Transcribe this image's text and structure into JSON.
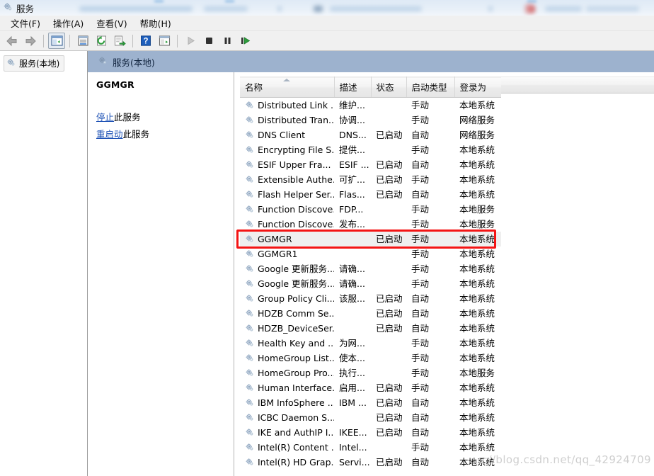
{
  "window": {
    "title": "服务",
    "icon": "services-gear-icon"
  },
  "menubar": {
    "items": [
      {
        "label": "文件(F)",
        "name": "menu-file"
      },
      {
        "label": "操作(A)",
        "name": "menu-action"
      },
      {
        "label": "查看(V)",
        "name": "menu-view"
      },
      {
        "label": "帮助(H)",
        "name": "menu-help"
      }
    ]
  },
  "toolbar": {
    "buttons": [
      {
        "name": "back-button",
        "icon": "left-arrow-icon",
        "enabled": true
      },
      {
        "name": "forward-button",
        "icon": "right-arrow-icon",
        "enabled": true
      },
      {
        "name": "show-hide-tree-button",
        "icon": "tree-panel-icon",
        "enabled": true
      },
      {
        "name": "properties-button",
        "icon": "properties-icon",
        "enabled": true
      },
      {
        "name": "refresh-button",
        "icon": "refresh-icon",
        "enabled": true
      },
      {
        "name": "export-list-button",
        "icon": "export-icon",
        "enabled": true
      },
      {
        "name": "help-button",
        "icon": "question-mark-icon",
        "enabled": true
      },
      {
        "name": "show-console-tree-button",
        "icon": "console-view-icon",
        "enabled": true
      },
      {
        "name": "start-service-button",
        "icon": "play-icon",
        "enabled": false
      },
      {
        "name": "stop-service-button",
        "icon": "stop-icon",
        "enabled": true
      },
      {
        "name": "pause-service-button",
        "icon": "pause-icon",
        "enabled": true
      },
      {
        "name": "restart-service-button",
        "icon": "restart-icon",
        "enabled": true
      }
    ]
  },
  "tree": {
    "items": [
      {
        "label": "服务(本地)",
        "name": "tree-item-services-local",
        "selected": true
      }
    ]
  },
  "content": {
    "header_title": "服务(本地)"
  },
  "details": {
    "service_name": "GGMGR",
    "links": [
      {
        "verb": "停止",
        "rest": "此服务",
        "name": "stop-this-service-link"
      },
      {
        "verb": "重启动",
        "rest": "此服务",
        "name": "restart-this-service-link"
      }
    ]
  },
  "table": {
    "columns": [
      {
        "label": "名称",
        "name": "column-name",
        "sorted": "asc"
      },
      {
        "label": "描述",
        "name": "column-description"
      },
      {
        "label": "状态",
        "name": "column-status"
      },
      {
        "label": "启动类型",
        "name": "column-startup-type"
      },
      {
        "label": "登录为",
        "name": "column-log-on-as"
      }
    ],
    "rows": [
      {
        "name": "Distributed Link ...",
        "description": "维护...",
        "status": "",
        "startup": "手动",
        "logon": "本地系统"
      },
      {
        "name": "Distributed Tran...",
        "description": "协调...",
        "status": "",
        "startup": "手动",
        "logon": "网络服务"
      },
      {
        "name": "DNS Client",
        "description": "DNS...",
        "status": "已启动",
        "startup": "自动",
        "logon": "网络服务"
      },
      {
        "name": "Encrypting File S...",
        "description": "提供...",
        "status": "",
        "startup": "手动",
        "logon": "本地系统"
      },
      {
        "name": "ESIF Upper Fra...",
        "description": "ESIF ...",
        "status": "已启动",
        "startup": "自动",
        "logon": "本地系统"
      },
      {
        "name": "Extensible Authe...",
        "description": "可扩...",
        "status": "已启动",
        "startup": "手动",
        "logon": "本地系统"
      },
      {
        "name": "Flash Helper Ser...",
        "description": "Flas...",
        "status": "已启动",
        "startup": "自动",
        "logon": "本地系统"
      },
      {
        "name": "Function Discove...",
        "description": "FDP...",
        "status": "",
        "startup": "手动",
        "logon": "本地服务"
      },
      {
        "name": "Function Discove...",
        "description": "发布...",
        "status": "",
        "startup": "手动",
        "logon": "本地服务"
      },
      {
        "name": "GGMGR",
        "description": "",
        "status": "已启动",
        "startup": "手动",
        "logon": "本地系统",
        "selected": true
      },
      {
        "name": "GGMGR1",
        "description": "",
        "status": "",
        "startup": "手动",
        "logon": "本地系统"
      },
      {
        "name": "Google 更新服务...",
        "description": "请确...",
        "status": "",
        "startup": "手动",
        "logon": "本地系统"
      },
      {
        "name": "Google 更新服务...",
        "description": "请确...",
        "status": "",
        "startup": "手动",
        "logon": "本地系统"
      },
      {
        "name": "Group Policy Cli...",
        "description": "该服...",
        "status": "已启动",
        "startup": "自动",
        "logon": "本地系统"
      },
      {
        "name": "HDZB Comm Se...",
        "description": "",
        "status": "已启动",
        "startup": "自动",
        "logon": "本地系统"
      },
      {
        "name": "HDZB_DeviceSer...",
        "description": "",
        "status": "已启动",
        "startup": "自动",
        "logon": "本地系统"
      },
      {
        "name": "Health Key and ...",
        "description": "为网...",
        "status": "",
        "startup": "手动",
        "logon": "本地系统"
      },
      {
        "name": "HomeGroup List...",
        "description": "使本...",
        "status": "",
        "startup": "手动",
        "logon": "本地系统"
      },
      {
        "name": "HomeGroup Pro...",
        "description": "执行...",
        "status": "",
        "startup": "手动",
        "logon": "本地服务"
      },
      {
        "name": "Human Interface...",
        "description": "启用...",
        "status": "已启动",
        "startup": "手动",
        "logon": "本地系统"
      },
      {
        "name": "IBM InfoSphere ...",
        "description": "IBM ...",
        "status": "已启动",
        "startup": "自动",
        "logon": "本地系统"
      },
      {
        "name": "ICBC Daemon S...",
        "description": "",
        "status": "已启动",
        "startup": "自动",
        "logon": "本地系统"
      },
      {
        "name": "IKE and AuthIP I...",
        "description": "IKEE...",
        "status": "已启动",
        "startup": "自动",
        "logon": "本地系统"
      },
      {
        "name": "Intel(R) Content ...",
        "description": "Intel...",
        "status": "",
        "startup": "手动",
        "logon": "本地系统"
      },
      {
        "name": "Intel(R) HD Grap...",
        "description": "Servi...",
        "status": "已启动",
        "startup": "自动",
        "logon": "本地系统"
      }
    ]
  },
  "annotation": {
    "highlight_target": "GGMGR",
    "color": "#f41414"
  },
  "watermark": {
    "text": "s://blog.csdn.net/qq_42924709"
  }
}
